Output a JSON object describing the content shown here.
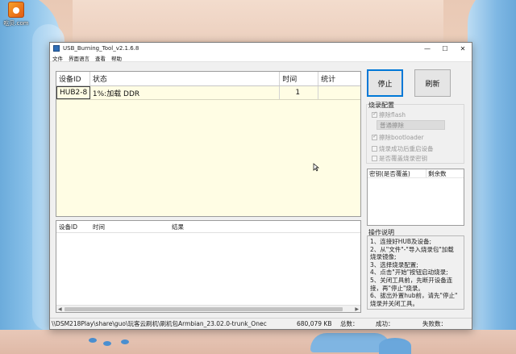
{
  "desktop": {
    "icon_label": "吃贝.com"
  },
  "window": {
    "title": "USB_Burning_Tool_v2.1.6.8",
    "minimize": "—",
    "maximize": "☐",
    "close": "✕"
  },
  "menu": [
    "文件",
    "界面语言",
    "查看",
    "帮助"
  ],
  "device_grid": {
    "headers": [
      "设备ID",
      "状态",
      "时间",
      "统计"
    ],
    "rows": [
      {
        "id": "HUB2-8",
        "status": "1%:加载 DDR",
        "time": "1",
        "stat": ""
      }
    ]
  },
  "log_grid": {
    "headers": [
      "设备ID",
      "时间",
      "结果"
    ]
  },
  "buttons": {
    "stop": "停止",
    "refresh": "刷新"
  },
  "config": {
    "title": "烧录配置",
    "erase_flash": "擦除flash",
    "erase_mode": "普通擦除",
    "erase_bootloader": "擦除bootloader",
    "reboot_after": "烧录成功后重启设备",
    "overwrite_key": "是否覆盖烧录密钥"
  },
  "key_table": {
    "headers": [
      "密钥(是否覆盖)",
      "剩余数"
    ]
  },
  "help": {
    "title": "操作说明",
    "lines": [
      "1、连接好HUB及设备;",
      "2、从\"文件\"-\"导入烧录包\"加载",
      "烧录镜像;",
      "3、选择烧录配置;",
      "4、点击\"开始\"按钮启动烧录;",
      "5、关闭工具前，先断开设备连",
      "接，再\"停止\"烧录。",
      "6、拔出外置hub前，请先\"停止\"",
      "烧录并关闭工具。"
    ]
  },
  "statusbar": {
    "path": "\\\\DSM218Play\\share\\guo\\玩客云刷机\\刷机包Armbian_23.02.0-trunk_Onec",
    "size": "680,079 KB",
    "total": "总数：",
    "success": "成功：",
    "fail": "失败数："
  }
}
